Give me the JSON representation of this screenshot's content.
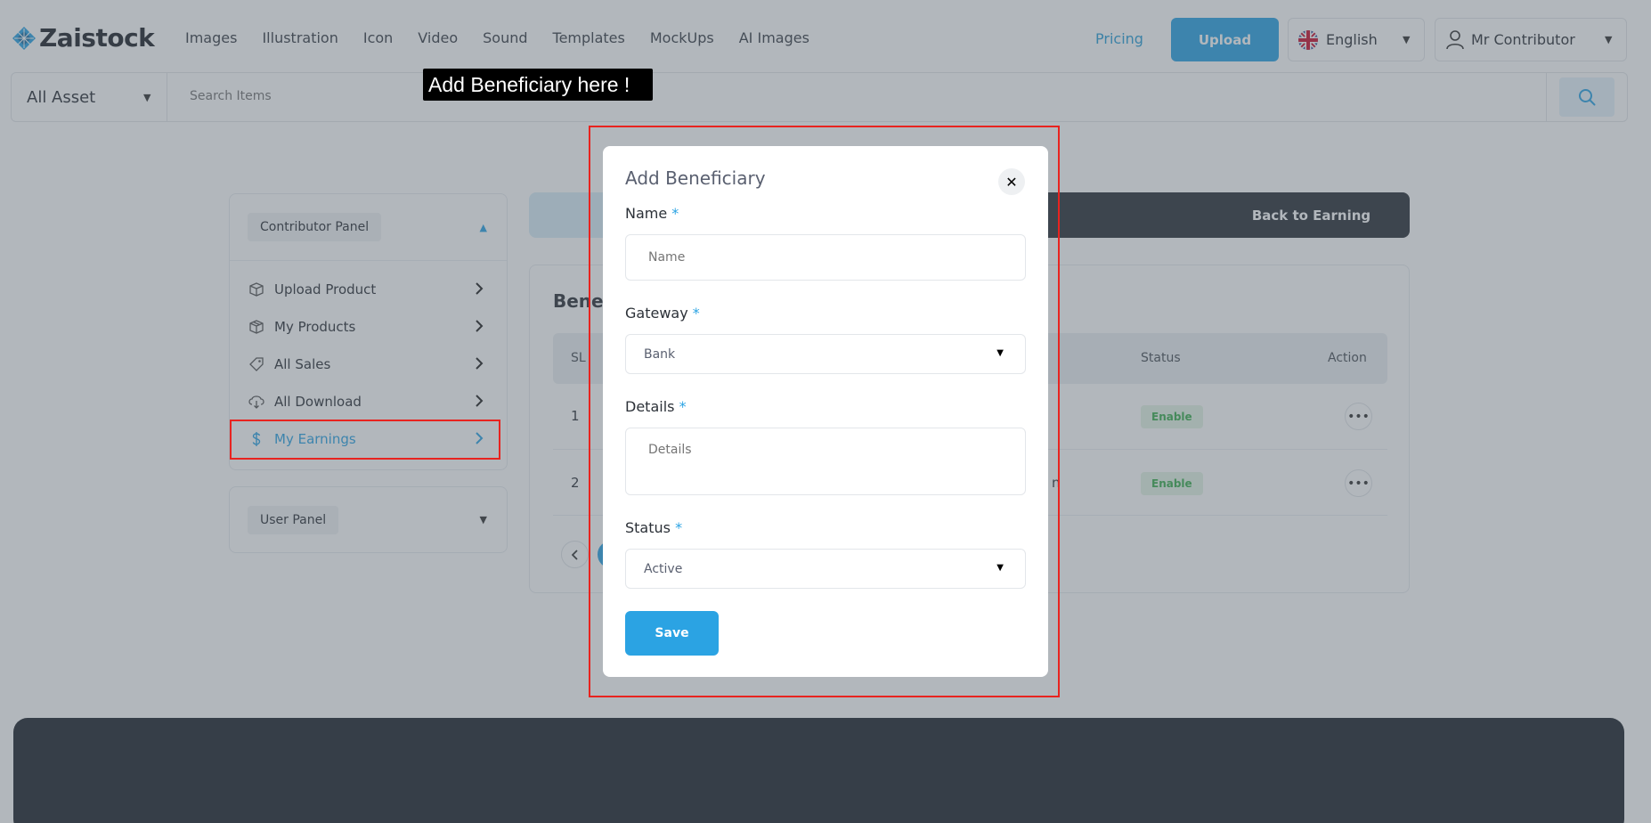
{
  "header": {
    "logo_text": "Zaistock",
    "nav": [
      "Images",
      "Illustration",
      "Icon",
      "Video",
      "Sound",
      "Templates",
      "MockUps",
      "AI Images"
    ],
    "pricing": "Pricing",
    "upload": "Upload",
    "language": "English",
    "user": "Mr Contributor"
  },
  "search": {
    "category": "All Asset",
    "placeholder": "Search Items"
  },
  "sidebar": {
    "contributor_panel": "Contributor Panel",
    "items": [
      {
        "label": "Upload Product",
        "icon": "upload-box-icon"
      },
      {
        "label": "My Products",
        "icon": "box-icon"
      },
      {
        "label": "All Sales",
        "icon": "tag-icon"
      },
      {
        "label": "All Download",
        "icon": "download-cloud-icon"
      },
      {
        "label": "My Earnings",
        "icon": "dollar-icon"
      }
    ],
    "user_panel": "User Panel"
  },
  "main": {
    "back_button": "Back to Earning",
    "card_title": "Benef",
    "table": {
      "headers": {
        "sl": "SL",
        "status": "Status",
        "action": "Action"
      },
      "rows": [
        {
          "sl": "1",
          "status": "Enable",
          "partial": ""
        },
        {
          "sl": "2",
          "status": "Enable",
          "partial": "n"
        }
      ]
    }
  },
  "tooltip": "Add Beneficiary here !",
  "modal": {
    "title": "Add Beneficiary",
    "name_label": "Name",
    "name_placeholder": "Name",
    "gateway_label": "Gateway",
    "gateway_value": "Bank",
    "details_label": "Details",
    "details_placeholder": "Details",
    "status_label": "Status",
    "status_value": "Active",
    "required_mark": "*",
    "save": "Save"
  },
  "colors": {
    "accent": "#2ba3e3",
    "highlight": "#e8231f",
    "dark": "#2b3038"
  }
}
